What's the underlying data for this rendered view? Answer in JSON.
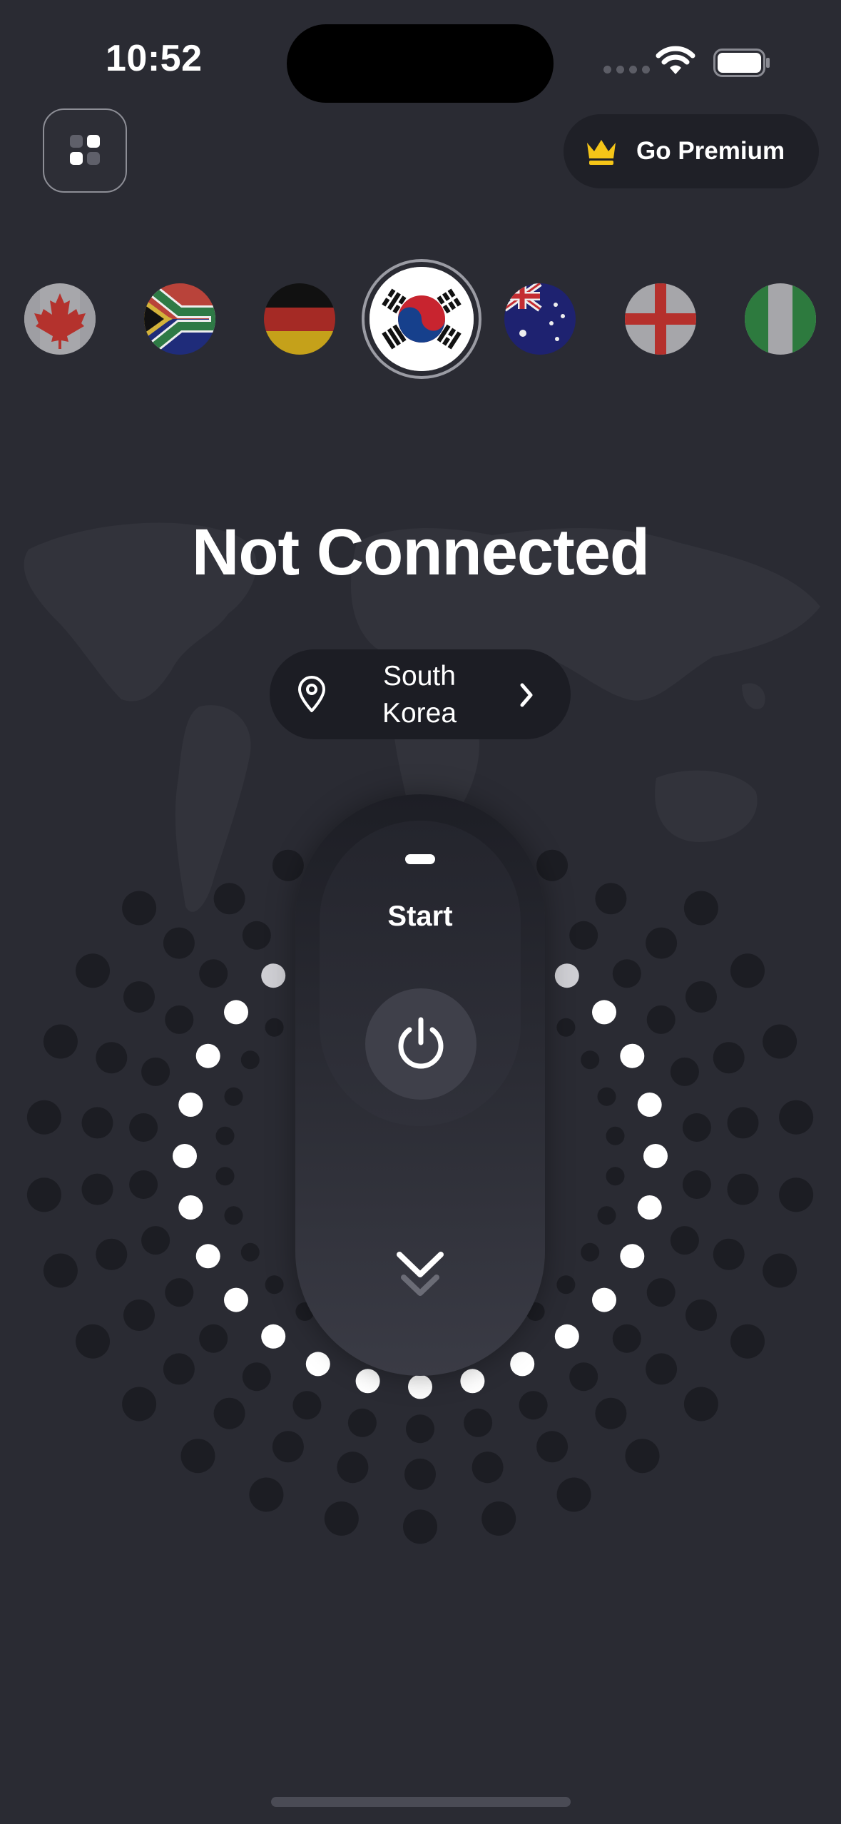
{
  "status_bar": {
    "time": "10:52"
  },
  "header": {
    "menu_icon": "grid-menu-icon",
    "premium_label": "Go Premium",
    "premium_icon": "crown-icon",
    "premium_icon_color": "#f5c518"
  },
  "countries": [
    {
      "name": "Canada",
      "icon": "canada-flag-icon",
      "selected": false
    },
    {
      "name": "South Africa",
      "icon": "south-africa-flag-icon",
      "selected": false
    },
    {
      "name": "Germany",
      "icon": "germany-flag-icon",
      "selected": false
    },
    {
      "name": "South Korea",
      "icon": "south-korea-flag-icon",
      "selected": true
    },
    {
      "name": "Australia",
      "icon": "australia-flag-icon",
      "selected": false
    },
    {
      "name": "England",
      "icon": "england-flag-icon",
      "selected": false
    },
    {
      "name": "Nigeria",
      "icon": "nigeria-flag-icon",
      "selected": false
    }
  ],
  "connection": {
    "status": "Not Connected",
    "location_line1": "South",
    "location_line2": "Korea",
    "location_icon": "map-pin-icon",
    "chevron_icon": "chevron-right-icon"
  },
  "control": {
    "start_label": "Start",
    "power_icon": "power-icon",
    "swipe_icon": "double-chevron-down-icon"
  },
  "colors": {
    "background": "#2a2b33",
    "pill": "#1c1d24",
    "dot_active": "#ffffff",
    "dot_inactive": "#1c1d23"
  }
}
